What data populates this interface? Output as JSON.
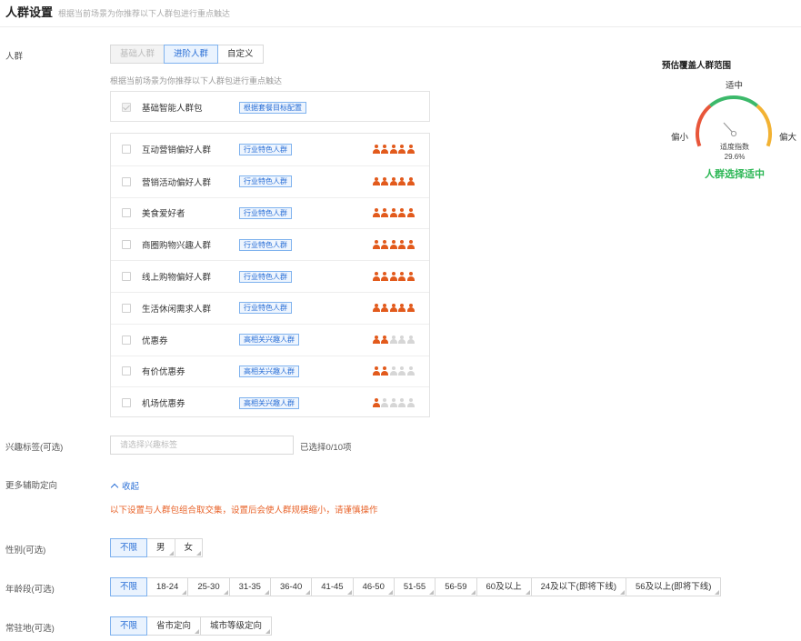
{
  "header": {
    "title": "人群设置",
    "subtitle": "根据当前场景为你推荐以下人群包进行重点触达"
  },
  "audience": {
    "label": "人群",
    "modes": [
      {
        "label": "基础人群",
        "state": "disabled"
      },
      {
        "label": "进阶人群",
        "state": "active"
      },
      {
        "label": "自定义",
        "state": "normal"
      }
    ],
    "hint": "根据当前场景为你推荐以下人群包进行重点触达",
    "base_package": {
      "name": "基础智能人群包",
      "tag": "根据套餐目标配置",
      "checked": true
    },
    "items": [
      {
        "name": "互动营销偏好人群",
        "tag": "行业特色人群",
        "level": 5
      },
      {
        "name": "营销活动偏好人群",
        "tag": "行业特色人群",
        "level": 5
      },
      {
        "name": "美食爱好者",
        "tag": "行业特色人群",
        "level": 5
      },
      {
        "name": "商圈购物兴趣人群",
        "tag": "行业特色人群",
        "level": 5
      },
      {
        "name": "线上购物偏好人群",
        "tag": "行业特色人群",
        "level": 5
      },
      {
        "name": "生活休闲需求人群",
        "tag": "行业特色人群",
        "level": 5
      },
      {
        "name": "优惠券",
        "tag": "高相关兴趣人群",
        "level": 2
      },
      {
        "name": "有价优惠券",
        "tag": "高相关兴趣人群",
        "level": 1.5
      },
      {
        "name": "机场优惠券",
        "tag": "高相关兴趣人群",
        "level": 1
      }
    ],
    "icon": "person-icon",
    "colors": {
      "on": "#e25a1c",
      "off": "#d6d6d6"
    }
  },
  "interest": {
    "label": "兴趣标签(可选)",
    "placeholder": "请选择兴趣标签",
    "selected": "已选择0/10项"
  },
  "more": {
    "label": "更多辅助定向",
    "collapse": "收起",
    "warning": "以下设置与人群包组合取交集，设置后会使人群规模缩小，请谨慎操作"
  },
  "gender": {
    "label": "性别(可选)",
    "options": [
      "不限",
      "男",
      "女"
    ],
    "selected": "不限"
  },
  "age": {
    "label": "年龄段(可选)",
    "options": [
      "不限",
      "18-24",
      "25-30",
      "31-35",
      "36-40",
      "41-45",
      "46-50",
      "51-55",
      "56-59",
      "60及以上",
      "24及以下(即将下线)",
      "56及以上(即将下线)"
    ],
    "selected": "不限"
  },
  "residence": {
    "label": "常驻地(可选)",
    "options": [
      "不限",
      "省市定向",
      "城市等级定向"
    ],
    "selected": "不限"
  },
  "gauge": {
    "title": "预估覆盖人群范围",
    "top": "适中",
    "left": "偏小",
    "right": "偏大",
    "index_label": "适度指数",
    "index_value": "29.6%",
    "status": "人群选择适中",
    "colors": {
      "low": "#e8563a",
      "mid": "#3cb96a",
      "high": "#f2b233"
    }
  }
}
